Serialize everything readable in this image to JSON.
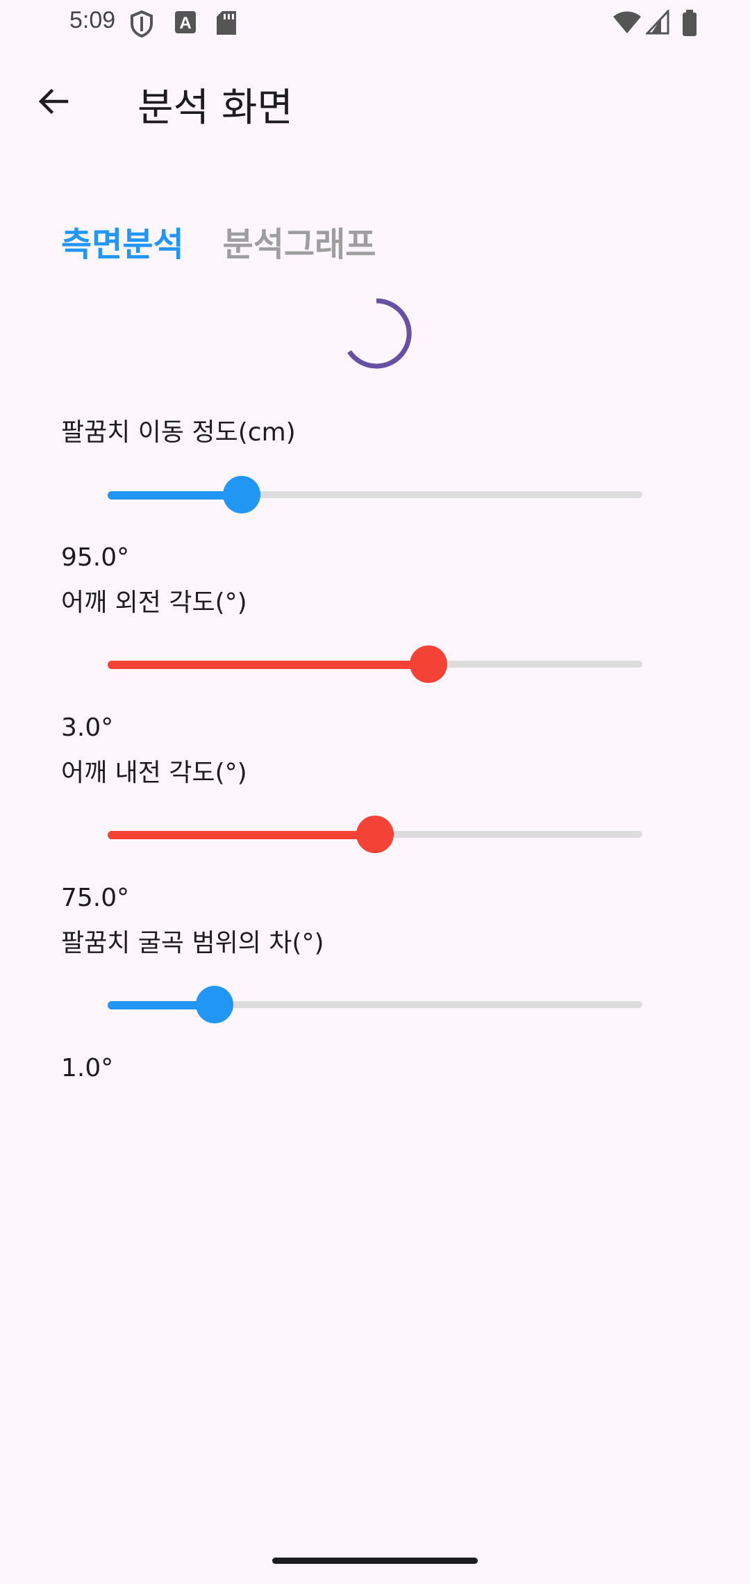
{
  "status_bar": {
    "time": "5:09",
    "left_icons": [
      "shield-icon",
      "font-a-icon",
      "sd-card-icon"
    ],
    "right_icons": [
      "wifi-icon",
      "signal-icon",
      "battery-icon"
    ]
  },
  "app_bar": {
    "back_icon": "arrow-back-icon",
    "title": "분석 화면"
  },
  "tabs": [
    {
      "label": "측면분석",
      "active": true
    },
    {
      "label": "분석그래프",
      "active": false
    }
  ],
  "colors": {
    "accent_blue": "#2196f3",
    "accent_red": "#f44336",
    "spinner": "#6750a4",
    "track": "#dcdcdc",
    "background": "#fdf7fd"
  },
  "sliders": [
    {
      "label": "팔꿈치 이동 정도(cm)",
      "value_text": "95.0°",
      "fraction": 0.25,
      "color": "#2196f3"
    },
    {
      "label": "어깨 외전 각도(°)",
      "value_text": "3.0°",
      "fraction": 0.6,
      "color": "#f44336"
    },
    {
      "label": "어깨 내전 각도(°)",
      "value_text": "75.0°",
      "fraction": 0.5,
      "color": "#f44336"
    },
    {
      "label": "팔꿈치 굴곡 범위의 차(°)",
      "value_text": "1.0°",
      "fraction": 0.2,
      "color": "#2196f3"
    }
  ]
}
